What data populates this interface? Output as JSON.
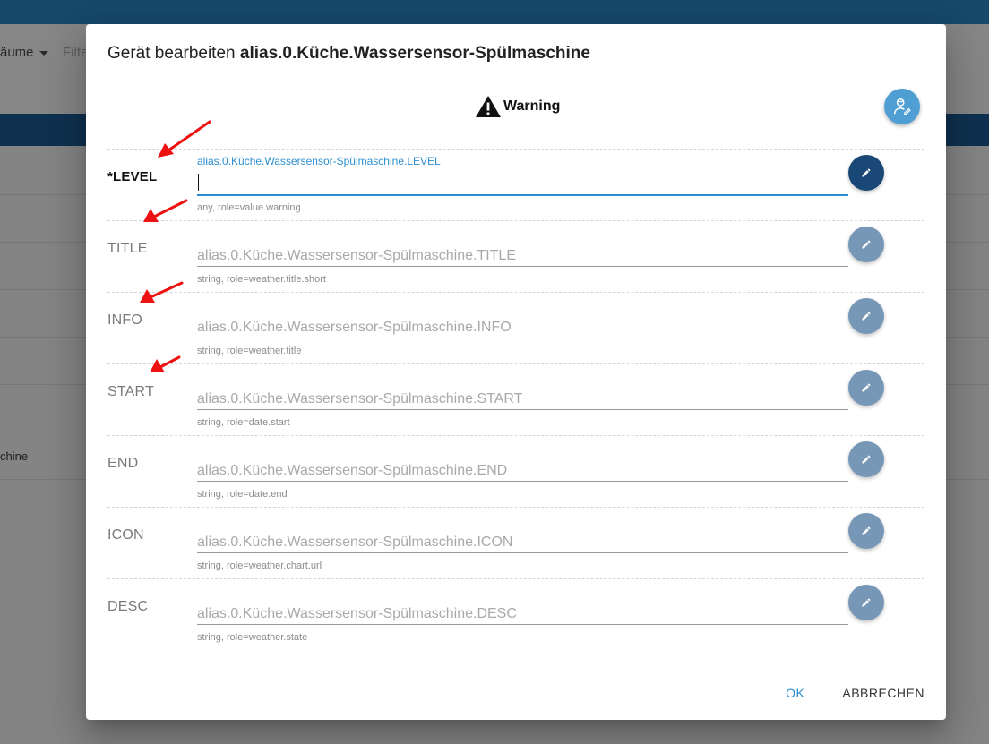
{
  "background": {
    "rooms_label": "äume",
    "filter_placeholder": "Filte",
    "list_item": "chine"
  },
  "dialog": {
    "title_prefix": "Gerät bearbeiten",
    "title_name": "alias.0.Küche.Wassersensor-Spülmaschine",
    "device_type": "Warning",
    "wizard_icon": "wizard-person-icon",
    "rows": [
      {
        "label": "*LEVEL",
        "floating": "alias.0.Küche.Wassersensor-Spülmaschine.LEVEL",
        "value": "",
        "placeholder": "",
        "helper": "any, role=value.warning"
      },
      {
        "label": "TITLE",
        "placeholder": "alias.0.Küche.Wassersensor-Spülmaschine.TITLE",
        "helper": "string, role=weather.title.short"
      },
      {
        "label": "INFO",
        "placeholder": "alias.0.Küche.Wassersensor-Spülmaschine.INFO",
        "helper": "string, role=weather.title"
      },
      {
        "label": "START",
        "placeholder": "alias.0.Küche.Wassersensor-Spülmaschine.START",
        "helper": "string, role=date.start"
      },
      {
        "label": "END",
        "placeholder": "alias.0.Küche.Wassersensor-Spülmaschine.END",
        "helper": "string, role=date.end"
      },
      {
        "label": "ICON",
        "placeholder": "alias.0.Küche.Wassersensor-Spülmaschine.ICON",
        "helper": "string, role=weather.chart.url"
      },
      {
        "label": "DESC",
        "placeholder": "alias.0.Küche.Wassersensor-Spülmaschine.DESC",
        "helper": "string, role=weather.state"
      }
    ],
    "ok_label": "OK",
    "cancel_label": "ABBRECHEN"
  },
  "colors": {
    "accent": "#2c8ecf",
    "edit_active": "#194877",
    "edit_inactive": "#7697b5",
    "annotation_arrow": "#ee1111"
  }
}
